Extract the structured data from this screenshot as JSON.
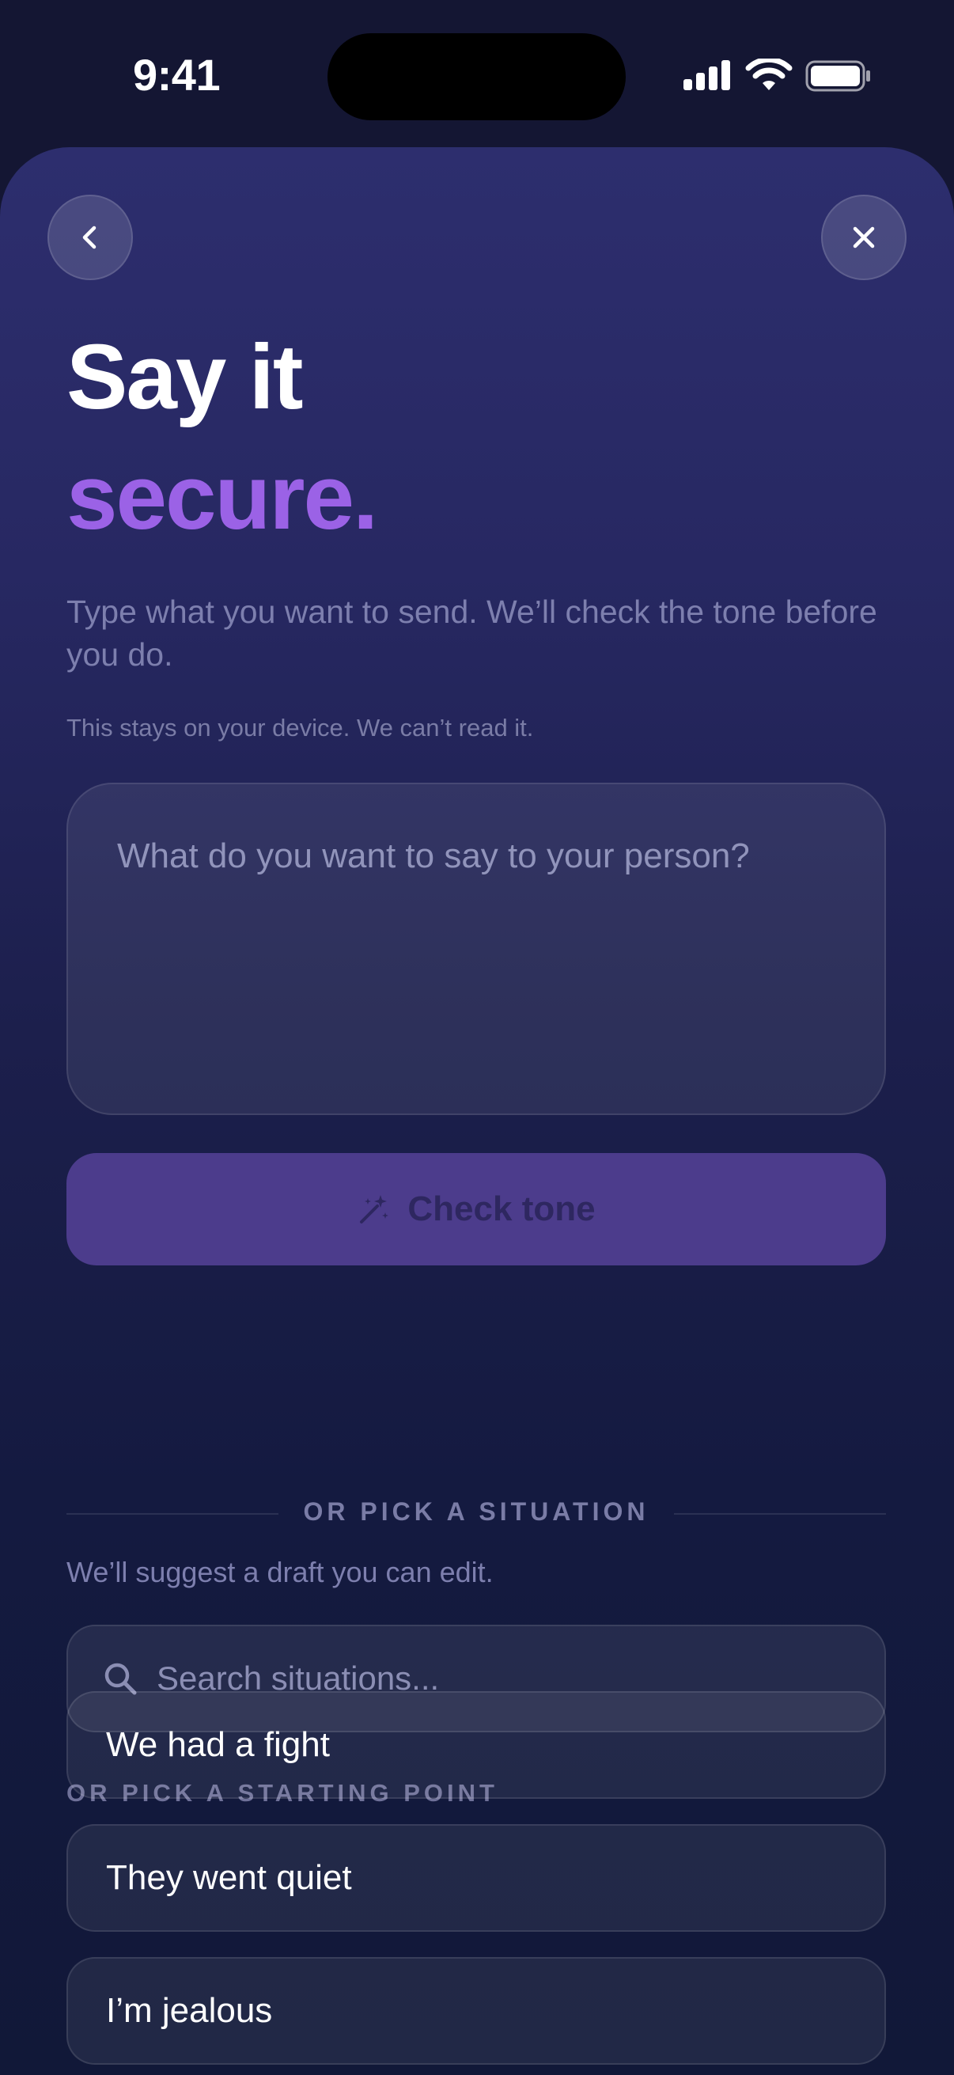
{
  "status_bar": {
    "time": "9:41"
  },
  "header": {
    "back_icon": "chevron-left-icon",
    "close_icon": "close-icon",
    "title_line1": "Say it",
    "title_line2": "secure.",
    "accent_color": "#9b62e6",
    "subtitle": "Type what you want to send. We’ll check the tone before you do.",
    "privacy_note": "This stays on your device. We can’t read it."
  },
  "composer": {
    "placeholder": "What do you want to say to your person?"
  },
  "check_tone": {
    "icon": "magic-wand-icon",
    "label": "Check tone",
    "button_color": "#4c3c8c"
  },
  "situations": {
    "divider_label": "OR PICK A SITUATION",
    "hint": "We’ll suggest a draft you can edit.",
    "search_placeholder": "Search situations..."
  },
  "starting_points": {
    "label": "OR PICK A STARTING POINT",
    "items": [
      {
        "label": "We had a fight"
      },
      {
        "label": "They went quiet"
      },
      {
        "label": "I’m jealous"
      }
    ]
  }
}
